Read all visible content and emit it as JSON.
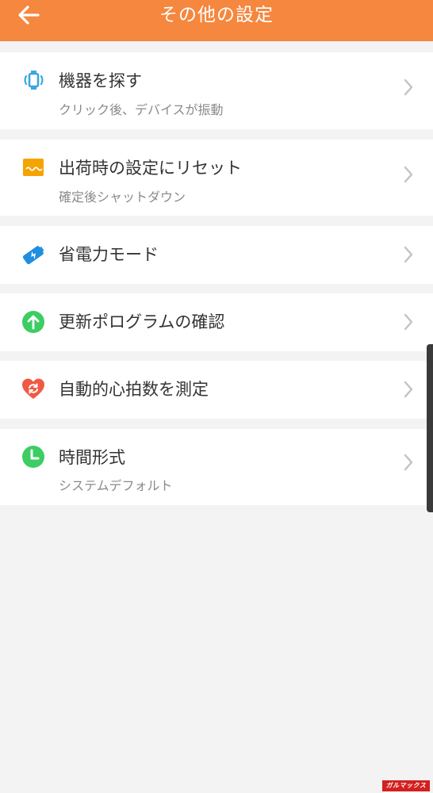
{
  "header": {
    "title": "その他の設定",
    "back_icon": "arrow-left-icon",
    "bg_color": "#f5873e"
  },
  "settings": [
    {
      "title": "機器を探す",
      "subtitle": "クリック後、デバイスが振動",
      "icon": "watch-vibrate-icon",
      "icon_color": "#3aa6dd"
    },
    {
      "title": "出荷時の設定にリセット",
      "subtitle": "確定後シャットダウン",
      "icon": "reset-icon",
      "icon_color": "#f5a300"
    },
    {
      "title": "省電力モード",
      "subtitle": "",
      "icon": "power-saving-icon",
      "icon_color": "#1f8ee0"
    },
    {
      "title": "更新ポログラムの確認",
      "subtitle": "",
      "icon": "update-icon",
      "icon_color": "#3dcd63"
    },
    {
      "title": "自動的心拍数を測定",
      "subtitle": "",
      "icon": "heart-rate-icon",
      "icon_color": "#f05a44"
    },
    {
      "title": "時間形式",
      "subtitle": "システムデフォルト",
      "icon": "clock-icon",
      "icon_color": "#3dcd63"
    }
  ],
  "watermark": "ガルマックス"
}
